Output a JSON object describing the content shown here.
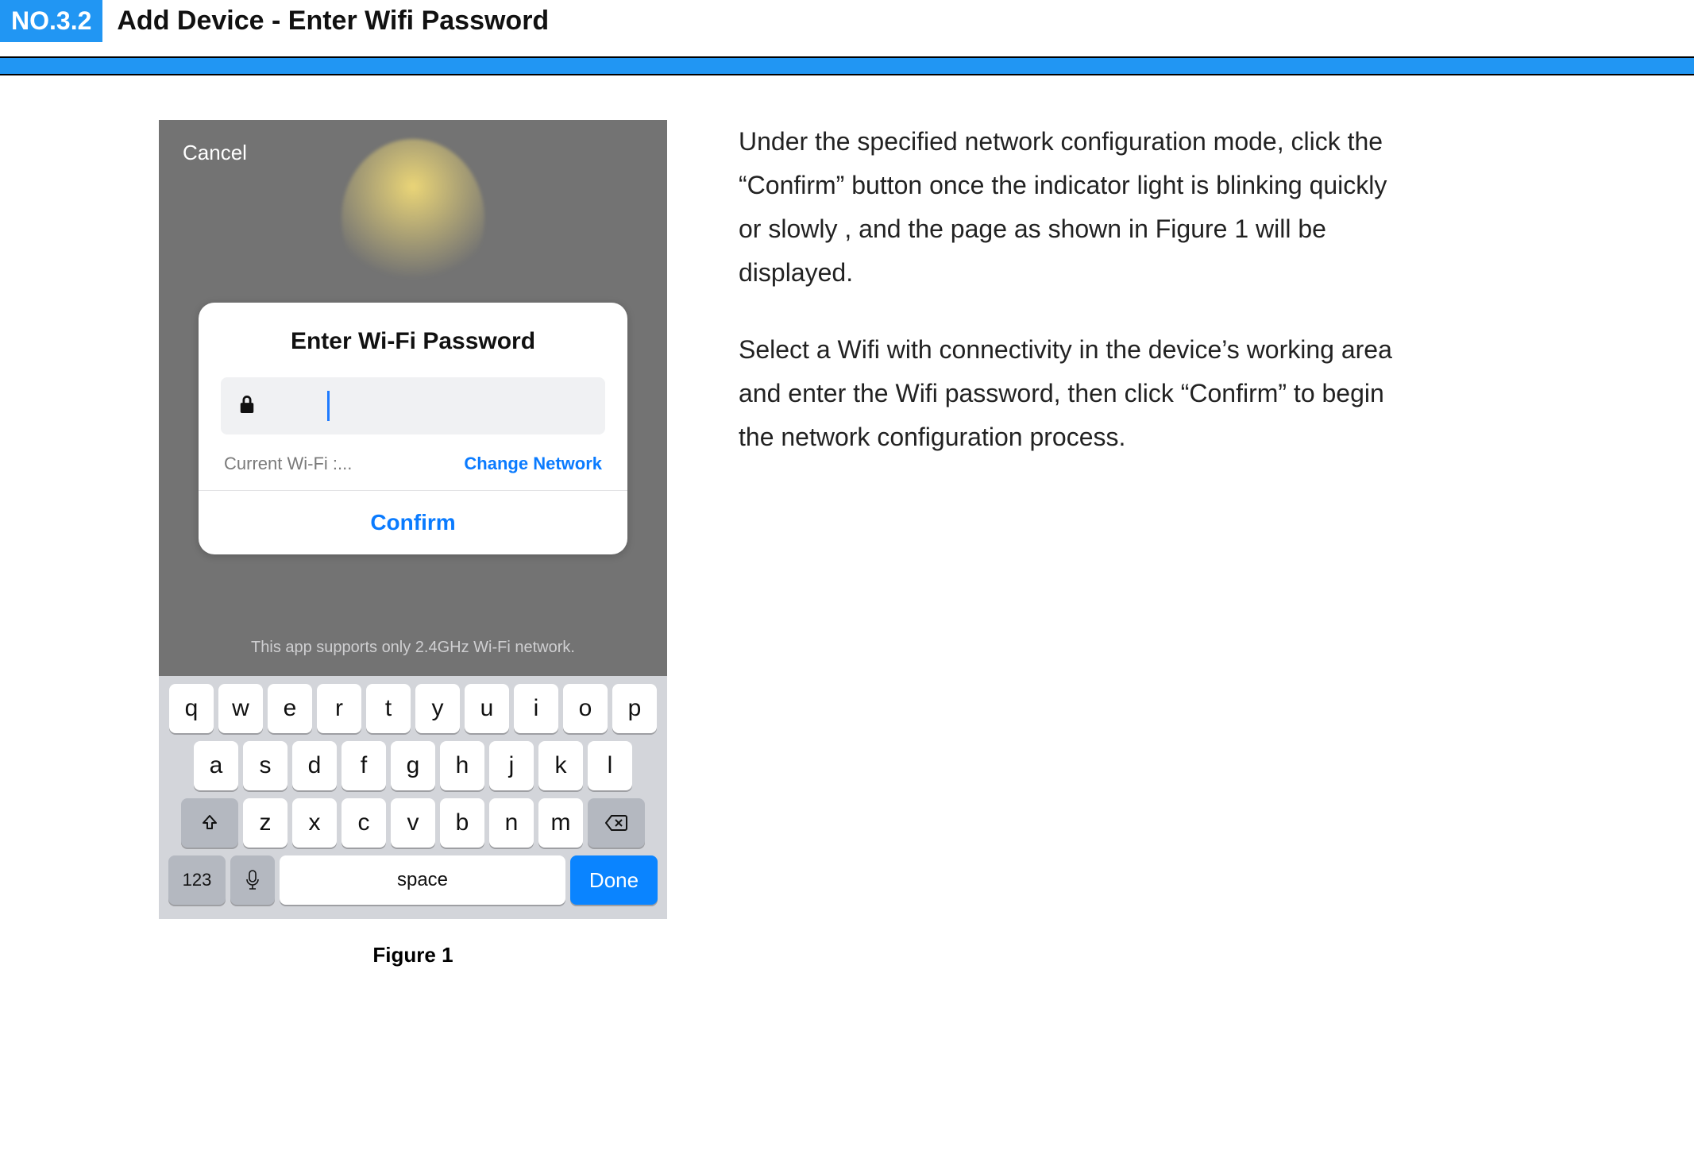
{
  "header": {
    "badge": "NO.3.2",
    "title": "Add Device - Enter Wifi Password"
  },
  "phone": {
    "cancel": "Cancel",
    "card_title": "Enter Wi-Fi Password",
    "wifi_label": "Current Wi-Fi :...",
    "change_network": "Change Network",
    "confirm": "Confirm",
    "support_note": "This app supports only 2.4GHz Wi-Fi network."
  },
  "keyboard": {
    "row1": [
      "q",
      "w",
      "e",
      "r",
      "t",
      "y",
      "u",
      "i",
      "o",
      "p"
    ],
    "row2": [
      "a",
      "s",
      "d",
      "f",
      "g",
      "h",
      "j",
      "k",
      "l"
    ],
    "row3": [
      "z",
      "x",
      "c",
      "v",
      "b",
      "n",
      "m"
    ],
    "key_123": "123",
    "space": "space",
    "done": "Done"
  },
  "figure_caption": "Figure 1",
  "description": {
    "p1": "Under the specified network configuration mode, click the “Confirm” button once the indicator light is blinking quickly or slowly , and the page as shown in Figure 1 will be displayed.",
    "p2": "Select a Wifi with connectivity  in the device’s working area and enter the Wifi password, then click “Confirm” to begin the network configuration process."
  }
}
